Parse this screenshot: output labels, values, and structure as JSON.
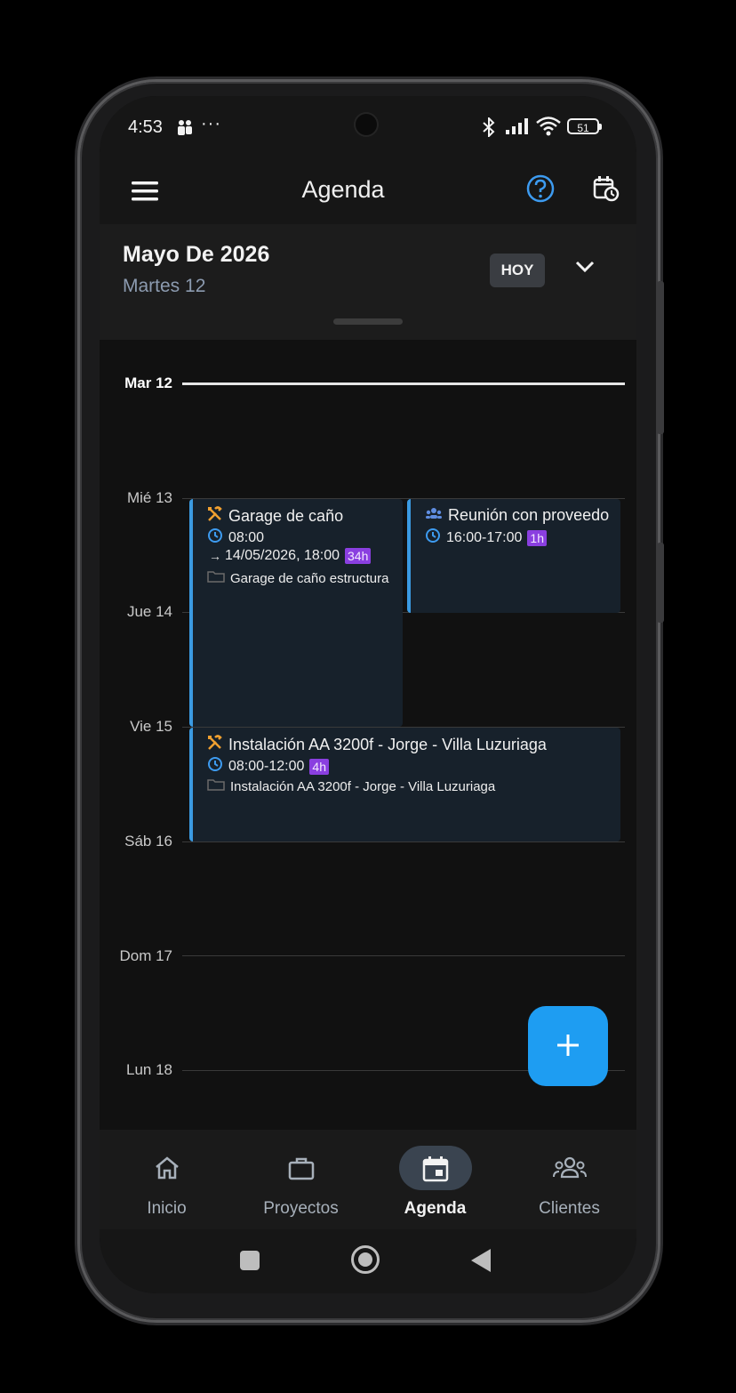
{
  "status_bar": {
    "time": "4:53",
    "more": "···",
    "battery": "51"
  },
  "app_bar": {
    "title": "Agenda",
    "icons": [
      "menu-icon",
      "help-icon",
      "calendar-clock-icon"
    ]
  },
  "header": {
    "month": "Mayo De 2026",
    "day": "Martes 12",
    "today_button": "HOY"
  },
  "days": [
    {
      "label": "Mar 12",
      "today": true
    },
    {
      "label": "Mié 13"
    },
    {
      "label": "Jue 14"
    },
    {
      "label": "Vie 15"
    },
    {
      "label": "Sáb 16"
    },
    {
      "label": "Dom 17"
    },
    {
      "label": "Lun 18"
    }
  ],
  "events": [
    {
      "title": "Garage de caño",
      "type_icon": "tools-icon",
      "time": "08:00",
      "end": "14/05/2026, 18:00",
      "duration": "34h",
      "project": "Garage de caño estructura"
    },
    {
      "title": "Reunión con proveedo",
      "type_icon": "group-icon",
      "time": "16:00-17:00",
      "duration": "1h"
    },
    {
      "title": "Instalación AA 3200f - Jorge - Villa Luzuriaga",
      "type_icon": "tools-icon",
      "time": "08:00-12:00",
      "duration": "4h",
      "project": "Instalación AA 3200f - Jorge - Villa Luzuriaga"
    }
  ],
  "fab": {
    "icon": "plus-icon"
  },
  "bottom_nav": [
    {
      "label": "Inicio",
      "icon": "home-icon"
    },
    {
      "label": "Proyectos",
      "icon": "briefcase-icon"
    },
    {
      "label": "Agenda",
      "icon": "calendar-icon",
      "active": true
    },
    {
      "label": "Clientes",
      "icon": "people-icon"
    }
  ],
  "colors": {
    "accent": "#1e9df2",
    "event_border": "#3b9ae1",
    "duration_badge": "#8a3fe0",
    "type_icon_orange": "#f0a030"
  }
}
